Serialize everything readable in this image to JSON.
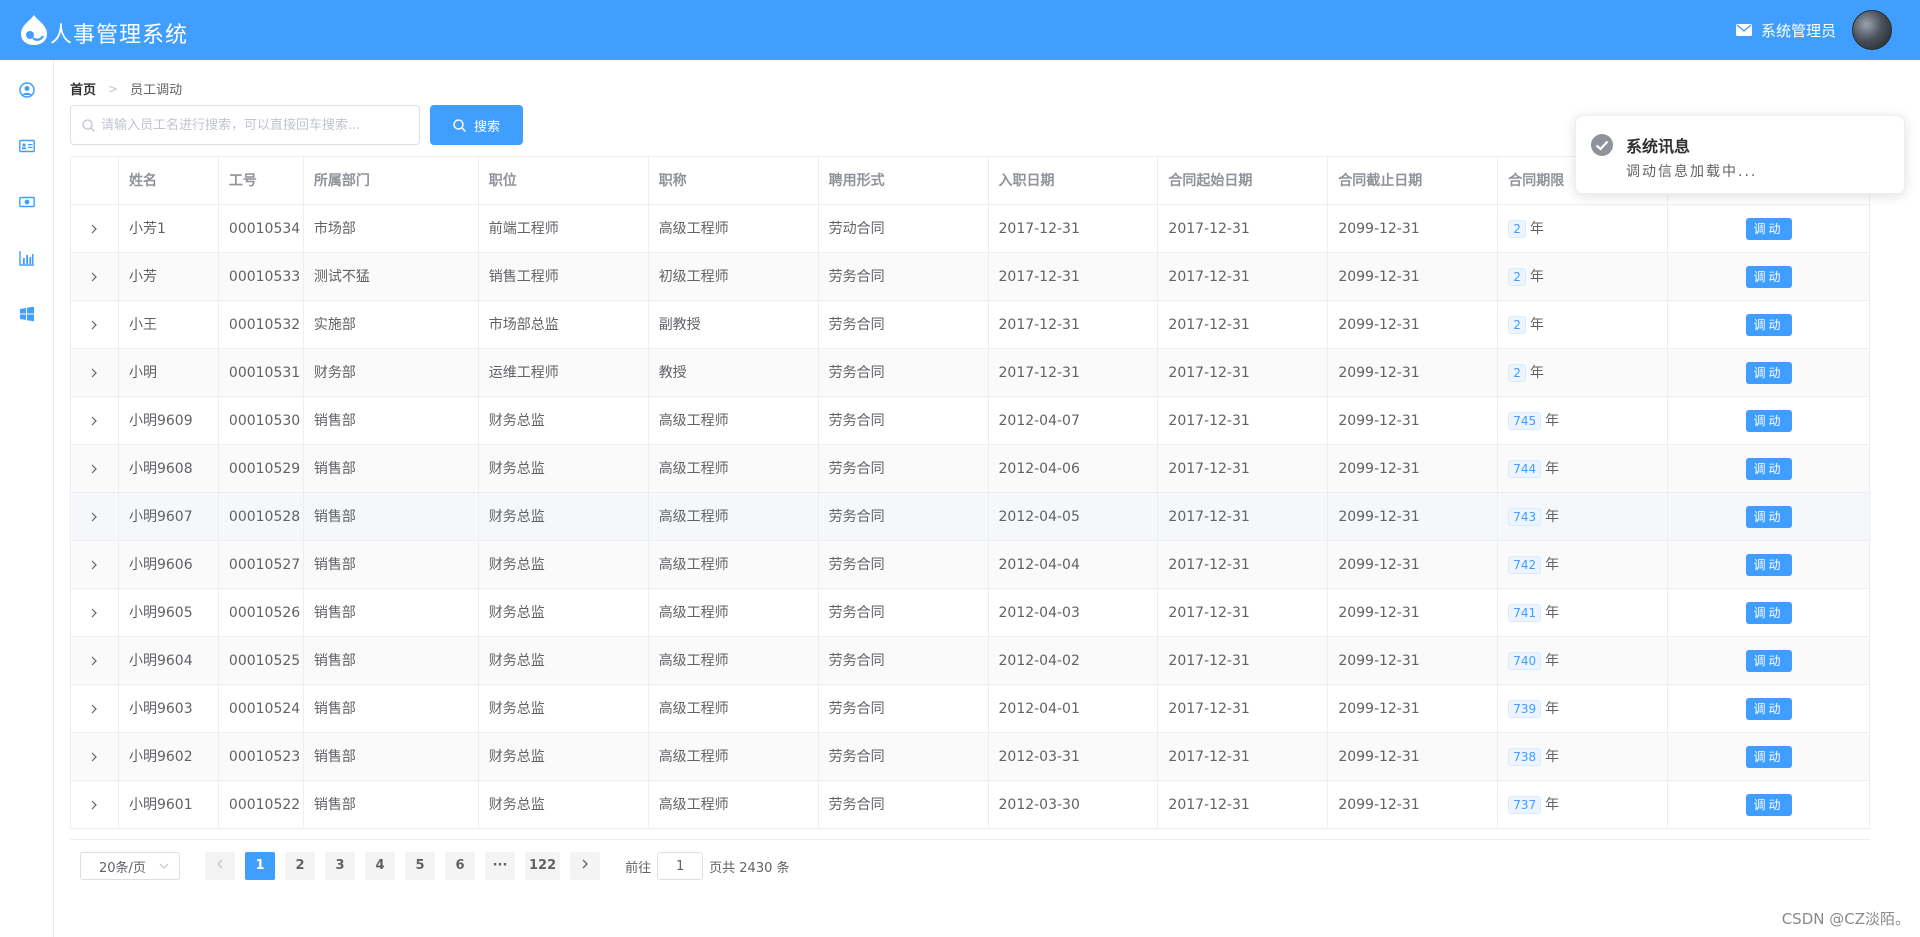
{
  "header": {
    "title": "人事管理系统",
    "admin_name": "系统管理员",
    "bg_color": "#409eff"
  },
  "sidebar": {
    "icons": [
      "user-circle-icon",
      "id-card-icon",
      "money-icon",
      "bar-chart-icon",
      "windows-icon"
    ]
  },
  "breadcrumb": {
    "home": "首页",
    "separator": ">",
    "current": "员工调动"
  },
  "search": {
    "placeholder": "请输入员工名进行搜索，可以直接回车搜索...",
    "button_label": "搜索"
  },
  "table": {
    "headers": [
      "",
      "姓名",
      "工号",
      "所属部门",
      "职位",
      "职称",
      "聘用形式",
      "入职日期",
      "合同起始日期",
      "合同截止日期",
      "合同期限",
      ""
    ],
    "rows": [
      {
        "name": "小芳1",
        "id": "00010534",
        "dept": "市场部",
        "position": "前端工程师",
        "title": "高级工程师",
        "employment": "劳动合同",
        "hire_date": "2017-12-31",
        "contract_start": "2017-12-31",
        "contract_end": "2099-12-31",
        "term": "2",
        "term_unit": "年",
        "action": "调动"
      },
      {
        "name": "小芳",
        "id": "00010533",
        "dept": "测试不猛",
        "position": "销售工程师",
        "title": "初级工程师",
        "employment": "劳务合同",
        "hire_date": "2017-12-31",
        "contract_start": "2017-12-31",
        "contract_end": "2099-12-31",
        "term": "2",
        "term_unit": "年",
        "action": "调动"
      },
      {
        "name": "小王",
        "id": "00010532",
        "dept": "实施部",
        "position": "市场部总监",
        "title": "副教授",
        "employment": "劳务合同",
        "hire_date": "2017-12-31",
        "contract_start": "2017-12-31",
        "contract_end": "2099-12-31",
        "term": "2",
        "term_unit": "年",
        "action": "调动"
      },
      {
        "name": "小明",
        "id": "00010531",
        "dept": "财务部",
        "position": "运维工程师",
        "title": "教授",
        "employment": "劳务合同",
        "hire_date": "2017-12-31",
        "contract_start": "2017-12-31",
        "contract_end": "2099-12-31",
        "term": "2",
        "term_unit": "年",
        "action": "调动"
      },
      {
        "name": "小明9609",
        "id": "00010530",
        "dept": "销售部",
        "position": "财务总监",
        "title": "高级工程师",
        "employment": "劳务合同",
        "hire_date": "2012-04-07",
        "contract_start": "2017-12-31",
        "contract_end": "2099-12-31",
        "term": "745",
        "term_unit": "年",
        "action": "调动"
      },
      {
        "name": "小明9608",
        "id": "00010529",
        "dept": "销售部",
        "position": "财务总监",
        "title": "高级工程师",
        "employment": "劳务合同",
        "hire_date": "2012-04-06",
        "contract_start": "2017-12-31",
        "contract_end": "2099-12-31",
        "term": "744",
        "term_unit": "年",
        "action": "调动"
      },
      {
        "name": "小明9607",
        "id": "00010528",
        "dept": "销售部",
        "position": "财务总监",
        "title": "高级工程师",
        "employment": "劳务合同",
        "hire_date": "2012-04-05",
        "contract_start": "2017-12-31",
        "contract_end": "2099-12-31",
        "term": "743",
        "term_unit": "年",
        "action": "调动"
      },
      {
        "name": "小明9606",
        "id": "00010527",
        "dept": "销售部",
        "position": "财务总监",
        "title": "高级工程师",
        "employment": "劳务合同",
        "hire_date": "2012-04-04",
        "contract_start": "2017-12-31",
        "contract_end": "2099-12-31",
        "term": "742",
        "term_unit": "年",
        "action": "调动"
      },
      {
        "name": "小明9605",
        "id": "00010526",
        "dept": "销售部",
        "position": "财务总监",
        "title": "高级工程师",
        "employment": "劳务合同",
        "hire_date": "2012-04-03",
        "contract_start": "2017-12-31",
        "contract_end": "2099-12-31",
        "term": "741",
        "term_unit": "年",
        "action": "调动"
      },
      {
        "name": "小明9604",
        "id": "00010525",
        "dept": "销售部",
        "position": "财务总监",
        "title": "高级工程师",
        "employment": "劳务合同",
        "hire_date": "2012-04-02",
        "contract_start": "2017-12-31",
        "contract_end": "2099-12-31",
        "term": "740",
        "term_unit": "年",
        "action": "调动"
      },
      {
        "name": "小明9603",
        "id": "00010524",
        "dept": "销售部",
        "position": "财务总监",
        "title": "高级工程师",
        "employment": "劳务合同",
        "hire_date": "2012-04-01",
        "contract_start": "2017-12-31",
        "contract_end": "2099-12-31",
        "term": "739",
        "term_unit": "年",
        "action": "调动"
      },
      {
        "name": "小明9602",
        "id": "00010523",
        "dept": "销售部",
        "position": "财务总监",
        "title": "高级工程师",
        "employment": "劳务合同",
        "hire_date": "2012-03-31",
        "contract_start": "2017-12-31",
        "contract_end": "2099-12-31",
        "term": "738",
        "term_unit": "年",
        "action": "调动"
      },
      {
        "name": "小明9601",
        "id": "00010522",
        "dept": "销售部",
        "position": "财务总监",
        "title": "高级工程师",
        "employment": "劳务合同",
        "hire_date": "2012-03-30",
        "contract_start": "2017-12-31",
        "contract_end": "2099-12-31",
        "term": "737",
        "term_unit": "年",
        "action": "调动"
      }
    ]
  },
  "pagination": {
    "page_size": "20条/页",
    "pages": [
      "1",
      "2",
      "3",
      "4",
      "5",
      "6",
      "···",
      "122"
    ],
    "current_page": "1",
    "goto_label": "前往",
    "goto_value": "1",
    "total_text": "页共 2430 条"
  },
  "notification": {
    "title": "系统讯息",
    "message": "调动信息加载中..."
  },
  "watermark": "CSDN @CZ淡陌。"
}
